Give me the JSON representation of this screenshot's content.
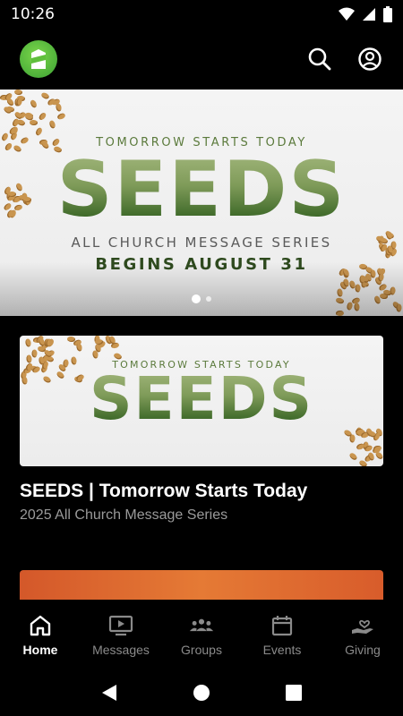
{
  "status_bar": {
    "time": "10:26"
  },
  "app_bar": {
    "logo_icon": "church-logo-icon",
    "actions": [
      "search-icon",
      "account-icon"
    ]
  },
  "hero": {
    "kicker": "TOMORROW STARTS TODAY",
    "title": "SEEDS",
    "subtitle": "ALL CHURCH MESSAGE SERIES",
    "date_line": "BEGINS AUGUST 31",
    "page_count": 2,
    "active_page": 1
  },
  "featured_card": {
    "image_kicker": "TOMORROW STARTS TODAY",
    "image_title": "SEEDS",
    "title": "SEEDS | Tomorrow Starts Today",
    "subtitle": "2025 All Church Message Series"
  },
  "bottom_nav": {
    "items": [
      {
        "label": "Home",
        "icon": "home-icon",
        "active": true
      },
      {
        "label": "Messages",
        "icon": "tv-play-icon",
        "active": false
      },
      {
        "label": "Groups",
        "icon": "groups-icon",
        "active": false
      },
      {
        "label": "Events",
        "icon": "calendar-icon",
        "active": false
      },
      {
        "label": "Giving",
        "icon": "giving-heart-hand-icon",
        "active": false
      }
    ]
  },
  "colors": {
    "accent_green": "#4caf50",
    "title_green": "#7f9b59",
    "background": "#000000"
  }
}
